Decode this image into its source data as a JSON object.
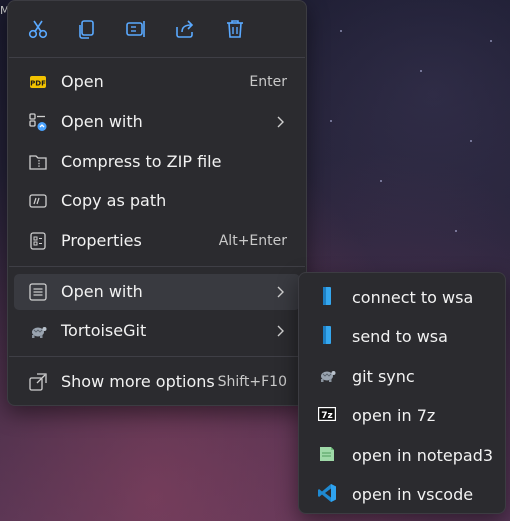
{
  "background": {
    "corner_text": "M"
  },
  "toolbar": {
    "buttons": [
      {
        "icon": "cut-icon"
      },
      {
        "icon": "copy-icon"
      },
      {
        "icon": "rename-icon"
      },
      {
        "icon": "share-icon"
      },
      {
        "icon": "delete-icon"
      }
    ]
  },
  "menu": {
    "items": [
      {
        "label": "Open",
        "shortcut": "Enter",
        "icon": "pdf-app-icon"
      },
      {
        "label": "Open with",
        "icon": "open-with-icon",
        "has_submenu": true
      },
      {
        "label": "Compress to ZIP file",
        "icon": "zip-folder-icon"
      },
      {
        "label": "Copy as path",
        "icon": "copy-path-icon"
      },
      {
        "label": "Properties",
        "shortcut": "Alt+Enter",
        "icon": "properties-icon"
      },
      {
        "label": "Open with",
        "icon": "list-icon",
        "has_submenu": true,
        "highlighted": true
      },
      {
        "label": "TortoiseGit",
        "icon": "tortoise-icon",
        "has_submenu": true
      },
      {
        "label": "Show more options",
        "shortcut": "Shift+F10",
        "icon": "show-more-icon"
      }
    ]
  },
  "submenu": {
    "items": [
      {
        "label": "connect to wsa",
        "icon": "wsa-icon"
      },
      {
        "label": "send to wsa",
        "icon": "wsa-icon"
      },
      {
        "label": "git sync",
        "icon": "tortoise-icon"
      },
      {
        "label": "open in 7z",
        "icon": "7z-icon"
      },
      {
        "label": "open in notepad3",
        "icon": "notepad3-icon"
      },
      {
        "label": "open in vscode",
        "icon": "vscode-icon"
      }
    ]
  },
  "colors": {
    "accent": "#4aa3ff",
    "menu_bg": "#2b2b2f",
    "hover_bg": "#393a40"
  }
}
